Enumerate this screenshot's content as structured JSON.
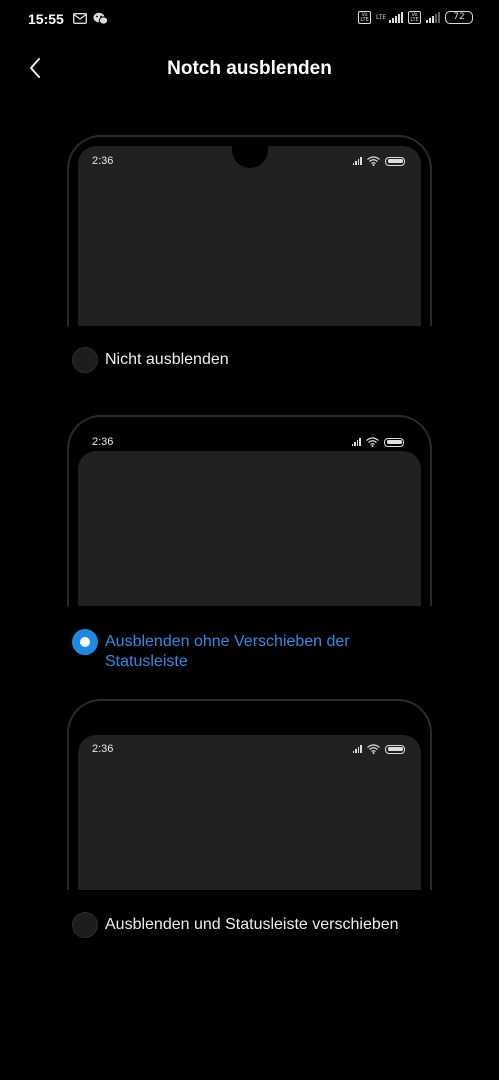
{
  "status_bar": {
    "time": "15:55",
    "left_icons": [
      "mail-icon",
      "wechat-icon"
    ],
    "volte_label": "Vo LTE",
    "lte_label": "LTE",
    "battery": "72"
  },
  "header": {
    "title": "Notch ausblenden",
    "back_icon": "chevron-left-icon"
  },
  "options": [
    {
      "label": "Nicht ausblenden",
      "preview_time": "2:36",
      "selected": false,
      "notch": true
    },
    {
      "label": "Ausblenden ohne Verschieben der Statusleiste",
      "preview_time": "2:36",
      "selected": true,
      "notch": false
    },
    {
      "label": "Ausblenden und Statusleiste verschieben",
      "preview_time": "2:36",
      "selected": false,
      "notch": false
    }
  ],
  "colors": {
    "background": "#000000",
    "accent": "#2b8ce8",
    "preview_screen": "#212121"
  }
}
